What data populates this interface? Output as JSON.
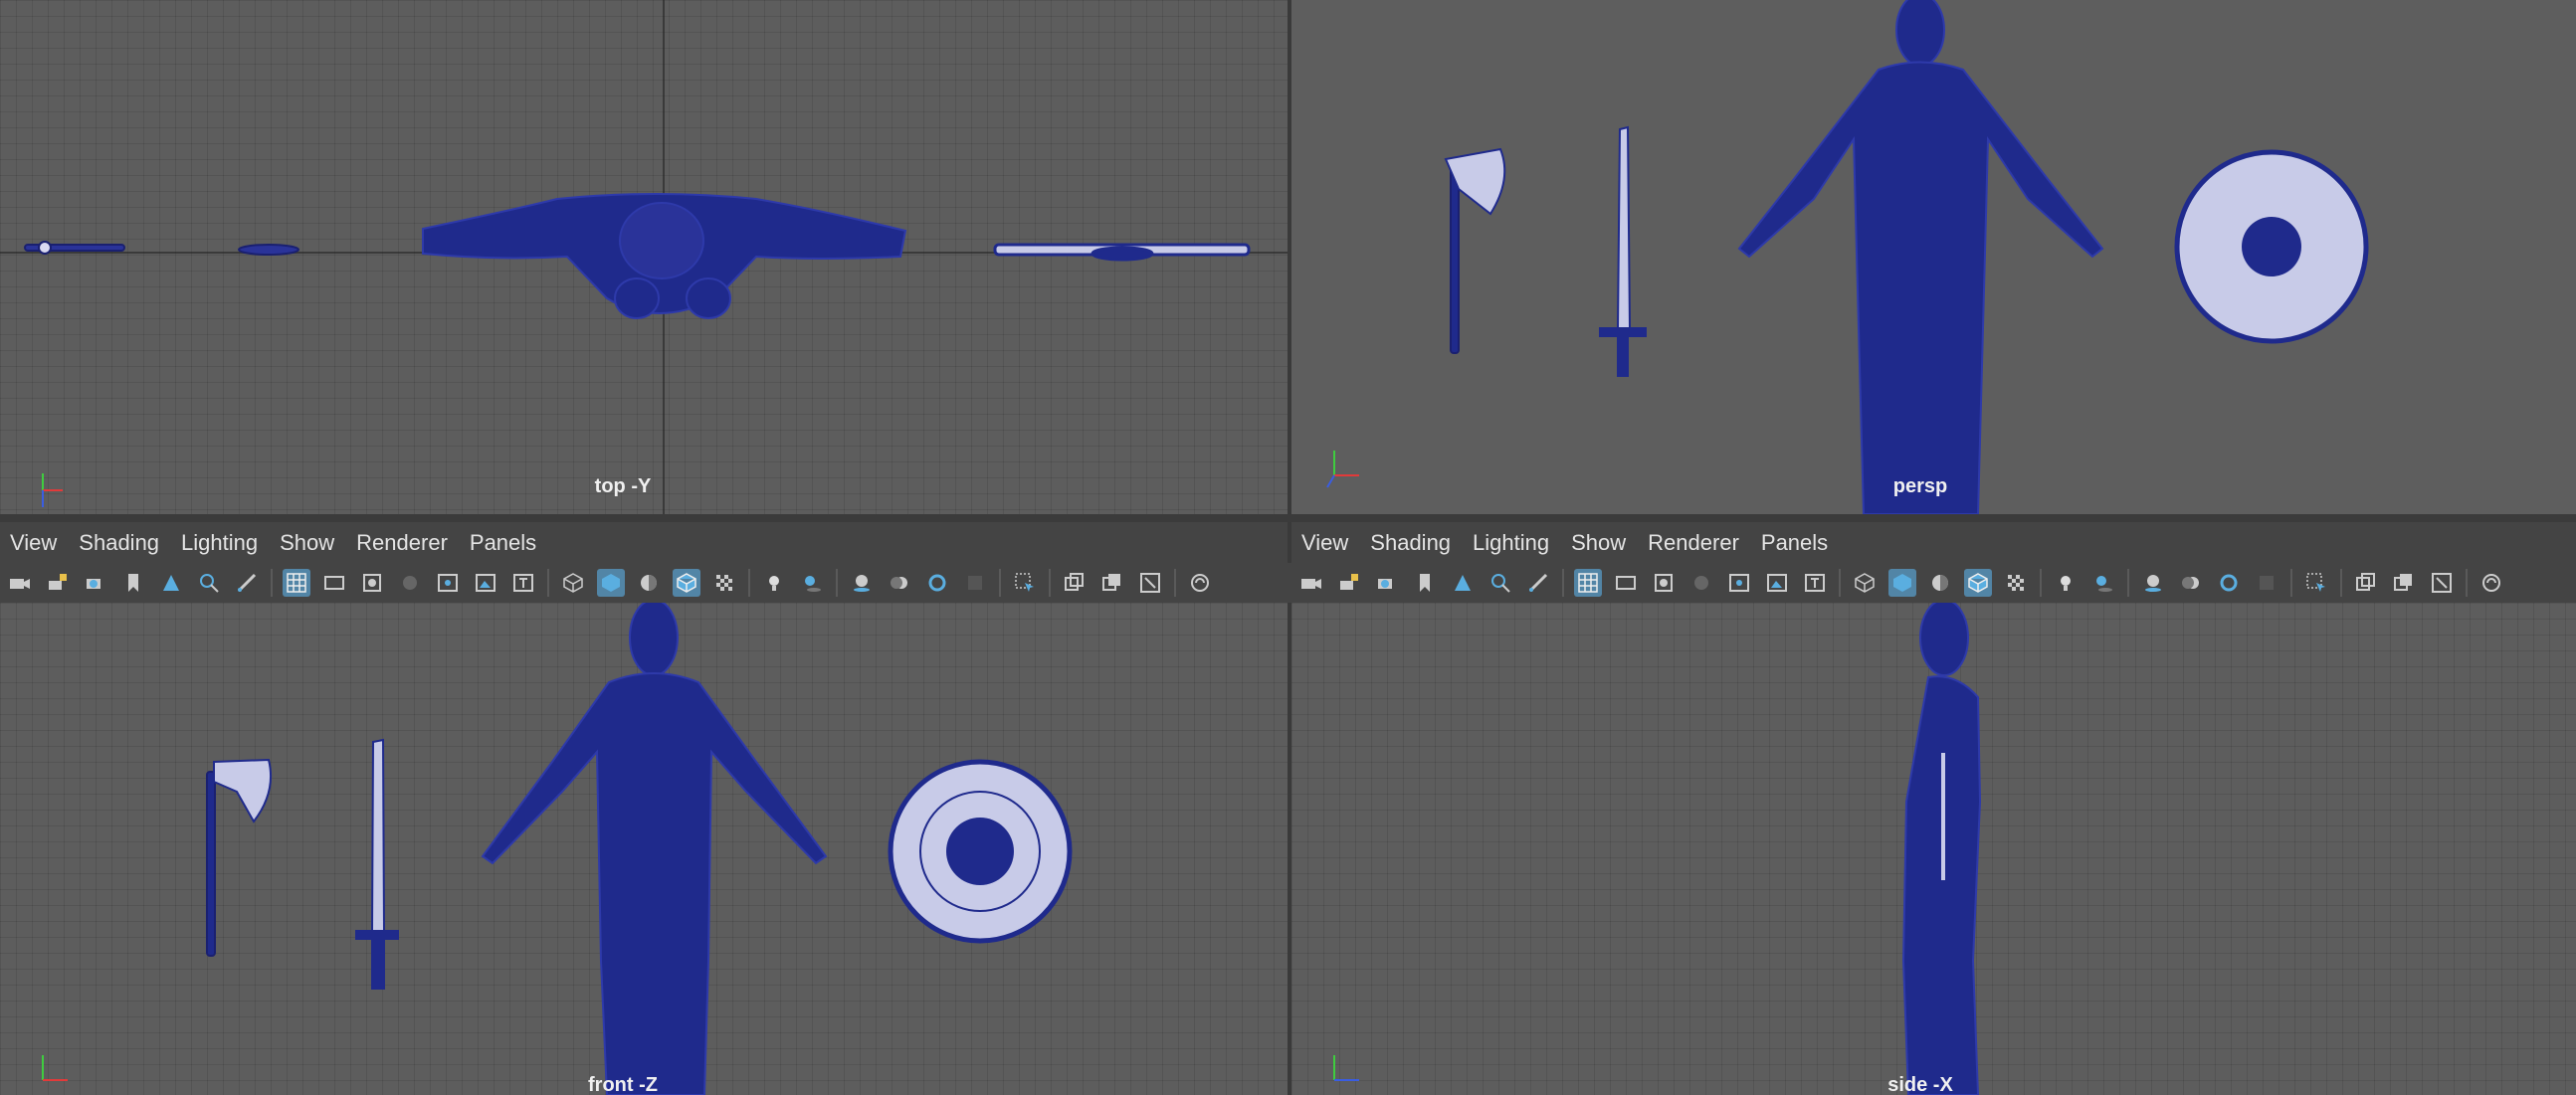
{
  "viewports": {
    "top": {
      "label": "top -Y",
      "axes": [
        "y",
        "x",
        "z"
      ]
    },
    "persp": {
      "label": "persp",
      "axes": [
        "y",
        "x",
        "z"
      ]
    },
    "front": {
      "label": "front -Z",
      "axes": [
        "y",
        "x",
        "z"
      ]
    },
    "side": {
      "label": "side -X",
      "axes": [
        "y",
        "z"
      ]
    }
  },
  "menu": [
    "View",
    "Shading",
    "Lighting",
    "Show",
    "Renderer",
    "Panels"
  ],
  "toolbar_icons": [
    "camera-icon",
    "lock-camera-icon",
    "camera-attributes-icon",
    "bookmark-icon",
    "image-plane-icon",
    "camera-zoom-icon",
    "grease-pencil-icon",
    "grid-icon",
    "film-gate-icon",
    "resolution-gate-icon",
    "gate-mask-icon",
    "field-chart-icon",
    "safe-action-icon",
    "safe-title-icon",
    "wireframe-icon",
    "smooth-shade-icon",
    "default-material-icon",
    "wireframe-on-shaded-icon",
    "textured-icon",
    "use-all-lights-icon",
    "shadows-icon",
    "screen-space-ao-icon",
    "motion-blur-icon",
    "multisample-aa-icon",
    "depth-of-field-icon",
    "isolate-select-icon",
    "xray-icon",
    "xray-joints-icon",
    "xray-components-icon",
    "backface-culling-icon"
  ],
  "colors": {
    "viewport_bg": "#5d5d5d",
    "mesh": "#1f2a8c",
    "toolbar_active": "#5285a6",
    "axis_x": "#e23a3a",
    "axis_y": "#3fcc3f",
    "axis_z": "#3a5de2"
  }
}
